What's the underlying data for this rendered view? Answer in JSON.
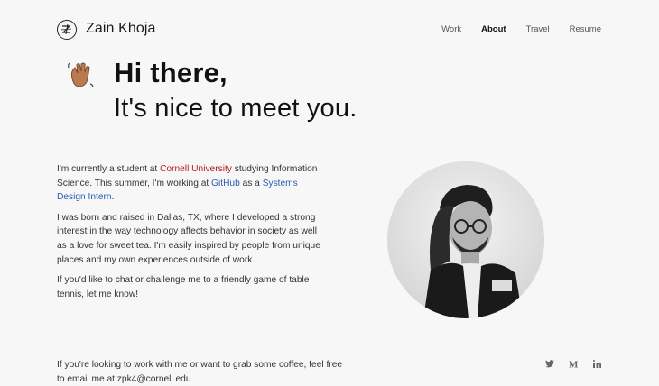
{
  "header": {
    "brand": "Zain Khoja",
    "nav": [
      "Work",
      "About",
      "Travel",
      "Resume"
    ],
    "active_nav": "About"
  },
  "hero": {
    "emoji": "wave-icon",
    "line1": "Hi there,",
    "line2": "It's nice to meet you."
  },
  "bio": {
    "p1_a": "I'm currently a student at ",
    "p1_link1": "Cornell University",
    "p1_b": " studying Information Science. This summer, I'm working at ",
    "p1_link2": "GitHub",
    "p1_c": " as a ",
    "p1_link3": "Systems Design Intern",
    "p1_d": ".",
    "p2": "I was born and raised in Dallas, TX, where I developed a strong interest in the way technology affects behavior in society as well as a love for sweet tea. I'm easily inspired by people from unique places and my own experiences outside of work.",
    "p3": "If you'd like to chat or challenge me to a friendly game of table tennis, let me know!"
  },
  "footer": {
    "text": "If you're looking to work with me or want to grab some coffee, feel free to email me at zpk4@cornell.edu",
    "socials": [
      "twitter-icon",
      "medium-icon",
      "linkedin-icon"
    ]
  },
  "colors": {
    "background": "#f7f7f7",
    "cornell": "#b31b1b",
    "link": "#2a5db0"
  }
}
